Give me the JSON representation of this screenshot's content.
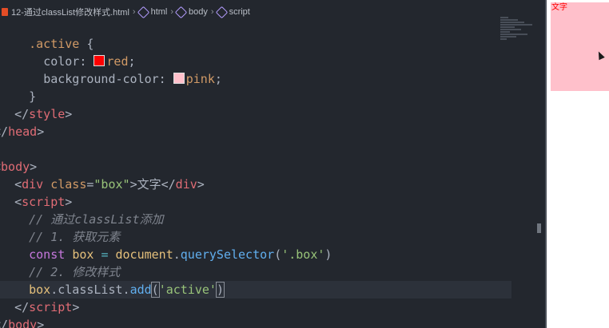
{
  "breadcrumb": {
    "file": "12-通过classList修改样式.html",
    "items": [
      "html",
      "body",
      "script"
    ]
  },
  "code": {
    "l1_sel": ".active",
    "l1_brace": " {",
    "l2_prop": "color:",
    "l2_val": "red",
    "l3_prop": "background-color:",
    "l3_val": "pink",
    "l4": "}",
    "l5_open": "</",
    "l5_tag": "style",
    "l5_close": ">",
    "l6_open": "</",
    "l6_tag": "head",
    "l6_close": ">",
    "l8_open": "<",
    "l8_tag": "body",
    "l8_close": ">",
    "l9_tag": "div",
    "l9_attr": "class",
    "l9_str": "\"box\"",
    "l9_text": "文字",
    "l10_tag": "script",
    "l11": "// 通过classList添加",
    "l12": "// 1. 获取元素",
    "l13_kw": "const",
    "l13_var": "box",
    "l13_obj": "document",
    "l13_fn": "querySelector",
    "l13_str": "'.box'",
    "l14": "// 2. 修改样式",
    "l15_obj": "box",
    "l15_prop": "classList",
    "l15_fn": "add",
    "l15_str": "'active'",
    "l16_tag": "script",
    "l17_tag": "body"
  },
  "colors": {
    "red_swatch": "#ff0000",
    "pink_swatch": "#ffc0cb"
  },
  "preview": {
    "box_text": "文字"
  }
}
